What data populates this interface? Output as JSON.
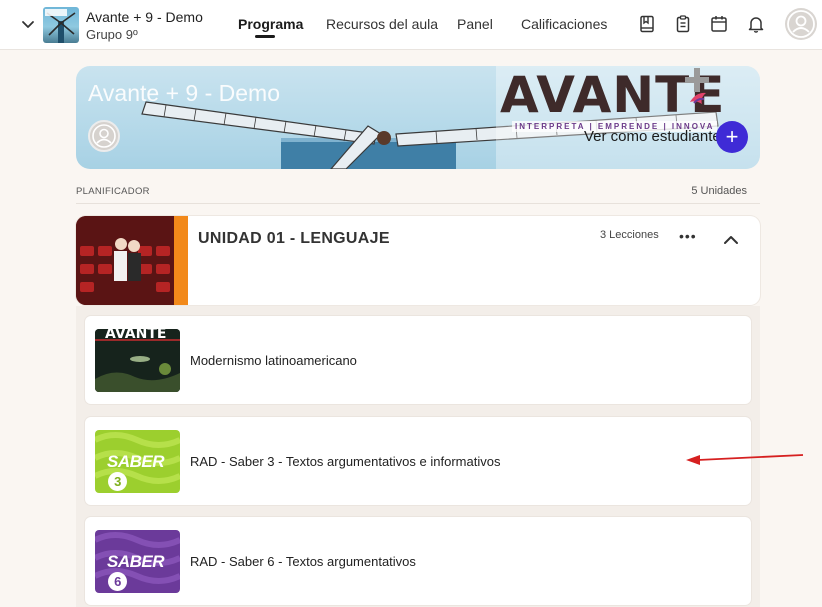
{
  "header": {
    "course_title": "Avante + 9 - Demo",
    "course_group": "Grupo 9º",
    "tabs": [
      {
        "label": "Programa",
        "active": true
      },
      {
        "label": "Recursos del aula",
        "active": false
      },
      {
        "label": "Panel",
        "active": false
      },
      {
        "label": "Calificaciones",
        "active": false
      }
    ],
    "icons": [
      "book-icon",
      "clipboard-icon",
      "calendar-icon",
      "bell-icon",
      "user-avatar-icon"
    ]
  },
  "banner": {
    "title": "Avante + 9 - Demo",
    "brand": "AVANTE",
    "tagline": "INTERPRETA | EMPRENDE | INNOVA",
    "view_as_student": "Ver como estudiante",
    "add_label": "+"
  },
  "planner": {
    "label": "PLANIFICADOR",
    "units_count": "5 Unidades"
  },
  "unit": {
    "title": "UNIDAD 01 - LENGUAJE",
    "lessons_count": "3 Lecciones",
    "more_label": "•••"
  },
  "lessons": [
    {
      "title": "Modernismo latinoamericano",
      "thumb_text": "AVANTE",
      "thumb": "avante"
    },
    {
      "title": "RAD - Saber 3 - Textos argumentativos e informativos",
      "thumb_text": "SABER",
      "thumb_num": "3",
      "thumb": "saber-green"
    },
    {
      "title": "RAD - Saber 6 - Textos argumentativos",
      "thumb_text": "SABER",
      "thumb_num": "6",
      "thumb": "saber-purple"
    }
  ],
  "colors": {
    "accent": "#3f2bd6",
    "unit_stripe": "#f2891a",
    "saber_green": "#9ccf2e",
    "saber_purple": "#6b3a9a",
    "annotation_arrow": "#d62020"
  }
}
